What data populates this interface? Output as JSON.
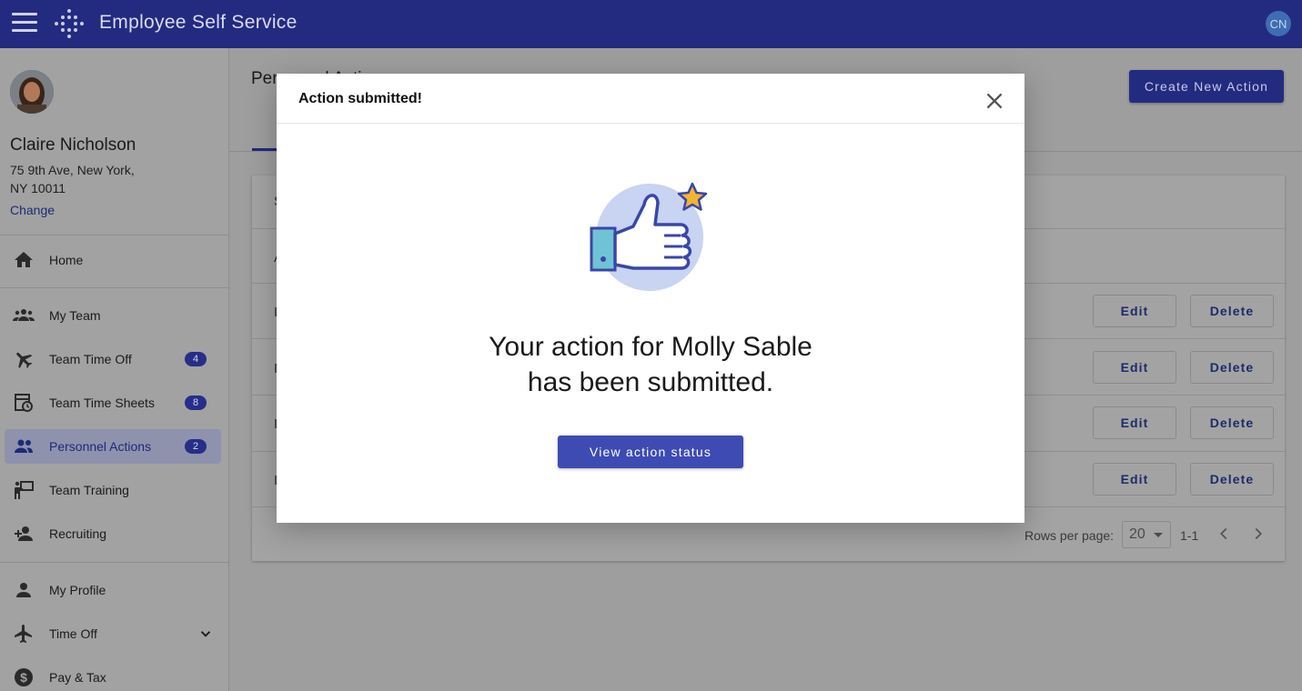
{
  "app": {
    "title": "Employee Self Service",
    "user_initials": "CN"
  },
  "sidebar": {
    "user_name": "Claire Nicholson",
    "address_line1": "75 9th Ave, New York,",
    "address_line2": "NY 10011",
    "change_label": "Change",
    "items": [
      {
        "label": "Home",
        "icon": "home-icon"
      },
      {
        "label": "My Team",
        "icon": "group-icon"
      },
      {
        "label": "Team Time Off",
        "icon": "airplane-icon",
        "badge": "4"
      },
      {
        "label": "Team Time Sheets",
        "icon": "timesheet-icon",
        "badge": "8"
      },
      {
        "label": "Personnel Actions",
        "icon": "people-icon",
        "badge": "2",
        "active": true
      },
      {
        "label": "Team Training",
        "icon": "training-icon"
      },
      {
        "label": "Recruiting",
        "icon": "add-person-icon"
      },
      {
        "label": "My Profile",
        "icon": "person-icon"
      },
      {
        "label": "Time Off",
        "icon": "airplane-icon",
        "expandable": true
      },
      {
        "label": "Pay & Tax",
        "icon": "dollar-icon"
      }
    ]
  },
  "main": {
    "heading": "Personnel Actions",
    "create_button": "Create New Action",
    "row_fragments": {
      "header": "S",
      "col": "A",
      "row": "I"
    },
    "rows": [
      {
        "edit": "Edit",
        "delete": "Delete"
      },
      {
        "edit": "Edit",
        "delete": "Delete"
      },
      {
        "edit": "Edit",
        "delete": "Delete"
      },
      {
        "edit": "Edit",
        "delete": "Delete"
      }
    ],
    "pagination": {
      "rows_per_page_label": "Rows per page:",
      "rows_per_page_value": "20",
      "range": "1-1"
    }
  },
  "modal": {
    "title": "Action submitted!",
    "message_line1": "Your action for Molly Sable",
    "message_line2": "has been submitted.",
    "button_label": "View action status"
  }
}
